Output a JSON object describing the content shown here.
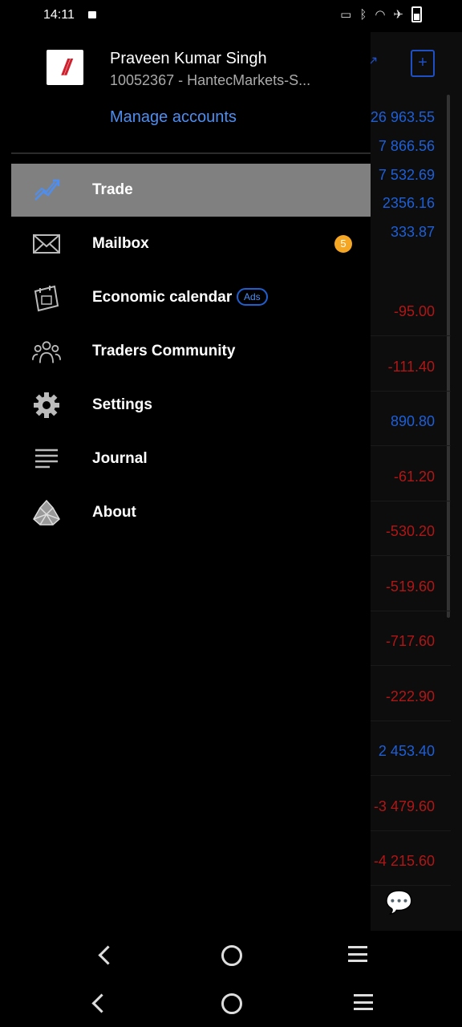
{
  "status": {
    "time": "14:11",
    "icons": [
      "cast-icon",
      "bluetooth-icon",
      "wifi-icon",
      "airplane-icon",
      "battery-icon"
    ]
  },
  "user": {
    "name": "Praveen Kumar Singh",
    "account": "10052367 - HantecMarkets-S...",
    "manage_label": "Manage accounts"
  },
  "menu": {
    "items": [
      {
        "label": "Trade",
        "icon": "trade-chart-icon",
        "active": true
      },
      {
        "label": "Mailbox",
        "icon": "mail-icon",
        "badge": "5"
      },
      {
        "label": "Economic calendar",
        "icon": "calendar-icon",
        "tag": "Ads"
      },
      {
        "label": "Traders Community",
        "icon": "community-icon"
      },
      {
        "label": "Settings",
        "icon": "gear-icon"
      },
      {
        "label": "Journal",
        "icon": "journal-icon"
      },
      {
        "label": "About",
        "icon": "about-icon"
      }
    ]
  },
  "background": {
    "values": [
      {
        "text": "26 963.55",
        "color": "blue"
      },
      {
        "text": "7 866.56",
        "color": "blue"
      },
      {
        "text": "7 532.69",
        "color": "blue"
      },
      {
        "text": "2356.16",
        "color": "blue"
      },
      {
        "text": "333.87",
        "color": "blue"
      },
      {
        "text": "-95.00",
        "color": "red"
      },
      {
        "text": "-111.40",
        "color": "red"
      },
      {
        "text": "890.80",
        "color": "blue"
      },
      {
        "text": "-61.20",
        "color": "red"
      },
      {
        "text": "-530.20",
        "color": "red"
      },
      {
        "text": "-519.60",
        "color": "red"
      },
      {
        "text": "-717.60",
        "color": "red"
      },
      {
        "text": "-222.90",
        "color": "red"
      },
      {
        "text": "2 453.40",
        "color": "blue"
      },
      {
        "text": "-3 479.60",
        "color": "red"
      },
      {
        "text": "-4 215.60",
        "color": "red"
      }
    ]
  },
  "colors": {
    "accent": "#4d8ef0",
    "active_row": "#808080",
    "badge": "#f5a623",
    "profit": "#1d5fd8",
    "loss": "#b11616"
  }
}
